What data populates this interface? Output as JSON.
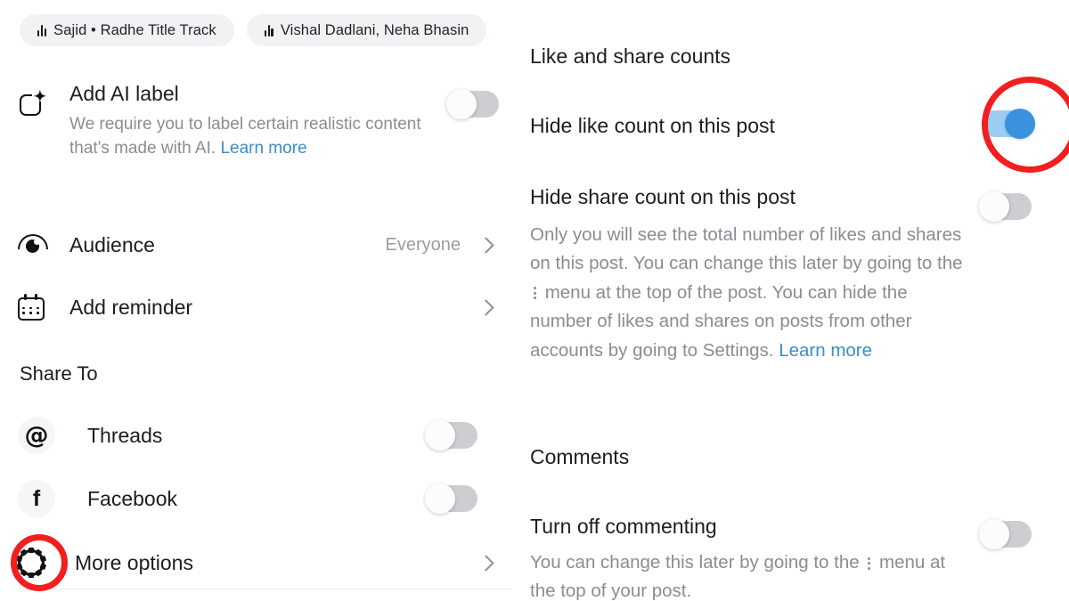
{
  "left_panel": {
    "chips": [
      {
        "icon": "audio-waveform-icon",
        "label": "Sajid • Radhe Title Track"
      },
      {
        "icon": "audio-waveform-icon",
        "label": "Vishal Dadlani, Neha Bhasin"
      }
    ],
    "ai_label": {
      "icon": "ai-sparkle-icon",
      "title": "Add AI label",
      "description_pre": "We require you to label certain realistic content that's made with AI. ",
      "description_link": "Learn more",
      "toggle_state": "off"
    },
    "rows": [
      {
        "icon": "eye-icon",
        "label": "Audience",
        "value": "Everyone",
        "accessory": "chevron-right-icon"
      },
      {
        "icon": "calendar-icon",
        "label": "Add reminder",
        "value": "",
        "accessory": "chevron-right-icon"
      }
    ],
    "share_to": {
      "header": "Share To",
      "items": [
        {
          "icon": "threads-icon",
          "label": "Threads",
          "toggle_state": "off"
        },
        {
          "icon": "facebook-icon",
          "label": "Facebook",
          "toggle_state": "off"
        },
        {
          "icon": "gear-icon",
          "label": "More options",
          "accessory": "chevron-right-icon"
        }
      ]
    }
  },
  "right_panel": {
    "sections": [
      {
        "header": "Like and share counts",
        "items": [
          {
            "title": "Hide like count on this post",
            "description": "",
            "toggle_state": "on"
          },
          {
            "title": "Hide share count on this post",
            "description_pre": "Only you will see the total number of likes and shares on this post. You can change this later by going to the ",
            "description_mid": " menu at the top of the post. You can hide the number of likes and shares on posts from other accounts by going to Settings. ",
            "description_link": "Learn more",
            "toggle_state": "off"
          }
        ]
      },
      {
        "header": "Comments",
        "items": [
          {
            "title": "Turn off commenting",
            "description_pre": "You can change this later by going to the ",
            "description_mid": " menu at the top of your post.",
            "toggle_state": "off"
          }
        ]
      }
    ]
  },
  "annotations": {
    "highlight_color": "#f21f1f",
    "circles": [
      {
        "target": "more-options-gear-icon"
      },
      {
        "target": "hide-like-count-toggle"
      }
    ]
  },
  "colors": {
    "toggle_on_track": "#9bcdf3",
    "toggle_on_knob": "#3a91e0",
    "toggle_off_track": "#cdced1",
    "link": "#3c8ec4",
    "primary_text": "#1c1d20",
    "secondary_text": "#8a8d91",
    "chip_background": "#f1f2f4"
  }
}
